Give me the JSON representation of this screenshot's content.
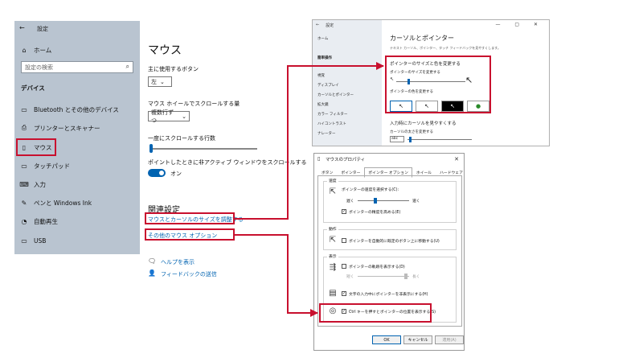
{
  "settings": {
    "back_label": "設定",
    "home": "ホーム",
    "search_placeholder": "設定の検索",
    "section": "デバイス",
    "items": [
      {
        "label": "Bluetooth とその他のデバイス"
      },
      {
        "label": "プリンターとスキャナー"
      },
      {
        "label": "マウス"
      },
      {
        "label": "タッチパッド"
      },
      {
        "label": "入力"
      },
      {
        "label": "ペンと Windows Ink"
      },
      {
        "label": "自動再生"
      },
      {
        "label": "USB"
      }
    ]
  },
  "mouse_page": {
    "title": "マウス",
    "primary_button_label": "主に使用するボタン",
    "primary_button_value": "左",
    "wheel_label": "マウス ホイールでスクロールする量",
    "wheel_value": "複数行ずつ",
    "lines_label": "一度にスクロールする行数",
    "inactive_label": "ポイントしたときに非アクティブ ウィンドウをスクロールする",
    "toggle_state": "オン",
    "related_heading": "関連設定",
    "link_cursor_size": "マウスとカーソルのサイズを調整する",
    "link_other_options": "その他のマウス オプション",
    "help": "ヘルプを表示",
    "feedback": "フィードバックの送信"
  },
  "pointer_window": {
    "titlebar": "設定",
    "home": "ホーム",
    "side_section": "簡単操作",
    "side_group": "視覚",
    "side_items": [
      "ディスプレイ",
      "カーソルとポインター",
      "拡大鏡",
      "カラー フィルター",
      "ハイコントラスト",
      "ナレーター"
    ],
    "title": "カーソルとポインター",
    "subtitle": "テキスト カーソル、ポインター、タッチ フィードバックを見やすくします。",
    "size_color_heading": "ポインターのサイズと色を変更する",
    "size_label": "ポインターのサイズを変更する",
    "color_label": "ポインターの色を変更する",
    "visibility_heading": "入力時にカーソルを見やすくする",
    "thickness_label": "カーソルの太さを変更する",
    "thickness_sample": "abc"
  },
  "mouse_props": {
    "title": "マウスのプロパティ",
    "tabs": [
      "ボタン",
      "ポインター",
      "ポインター オプション",
      "ホイール",
      "ハードウェア"
    ],
    "speed_group": "速度",
    "speed_label": "ポインターの速度を選択する(C):",
    "slow": "遅く",
    "fast": "速く",
    "precision": "ポインターの精度を高める(E)",
    "snap_group": "動作",
    "snap": "ポインターを自動的に既定のボタン上に移動する(U)",
    "visibility_group": "表示",
    "trails": "ポインターの軌跡を表示する(D)",
    "short": "短く",
    "long": "長く",
    "hide_typing": "文字の入力中にポインターを非表示にする(H)",
    "ctrl_show": "Ctrl キーを押すとポインターの位置を表示する(S)",
    "ok": "OK",
    "cancel": "キャンセル",
    "apply": "適用(A)"
  }
}
